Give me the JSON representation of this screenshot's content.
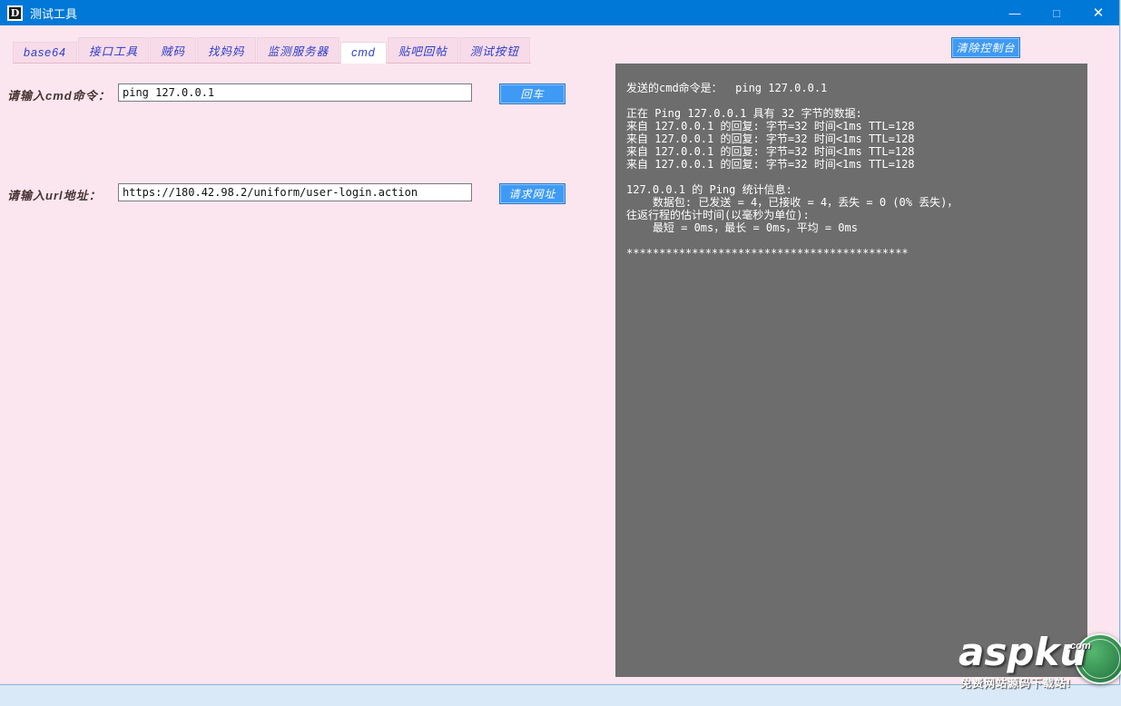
{
  "window": {
    "title": "测试工具",
    "icon_text": "D",
    "controls": {
      "minimize": "—",
      "maximize": "□",
      "close": "✕"
    }
  },
  "tabs": [
    {
      "label": "base64",
      "active": false
    },
    {
      "label": "接口工具",
      "active": false
    },
    {
      "label": "贼码",
      "active": false
    },
    {
      "label": "找妈妈",
      "active": false
    },
    {
      "label": "监测服务器",
      "active": false
    },
    {
      "label": "cmd",
      "active": true
    },
    {
      "label": "贴吧回帖",
      "active": false
    },
    {
      "label": "测试按钮",
      "active": false
    }
  ],
  "toolbar": {
    "clear_button": "清除控制台"
  },
  "form": {
    "cmd_label": "请输入cmd命令：",
    "cmd_value": "ping 127.0.0.1",
    "enter_button": "回车",
    "url_label": "请输入url地址：",
    "url_value": "https://180.42.98.2/uniform/user-login.action",
    "request_button": "请求网址"
  },
  "console": {
    "lines": [
      "发送的cmd命令是：  ping 127.0.0.1",
      "",
      "正在 Ping 127.0.0.1 具有 32 字节的数据:",
      "来自 127.0.0.1 的回复: 字节=32 时间<1ms TTL=128",
      "来自 127.0.0.1 的回复: 字节=32 时间<1ms TTL=128",
      "来自 127.0.0.1 的回复: 字节=32 时间<1ms TTL=128",
      "来自 127.0.0.1 的回复: 字节=32 时间<1ms TTL=128",
      "",
      "127.0.0.1 的 Ping 统计信息:",
      "    数据包: 已发送 = 4，已接收 = 4，丢失 = 0 (0% 丢失)，",
      "往返行程的估计时间(以毫秒为单位):",
      "    最短 = 0ms，最长 = 0ms，平均 = 0ms",
      "",
      "*******************************************"
    ]
  },
  "watermark": {
    "brand": "aspku",
    "suffix": ".com",
    "tagline": "免费网站源码下载站!"
  },
  "colors": {
    "titlebar": "#0078d7",
    "window_bg": "#fbe6ef",
    "console_bg": "#6d6d6d",
    "button_bg": "#3e9af5",
    "tab_text": "#2b3cc8"
  }
}
